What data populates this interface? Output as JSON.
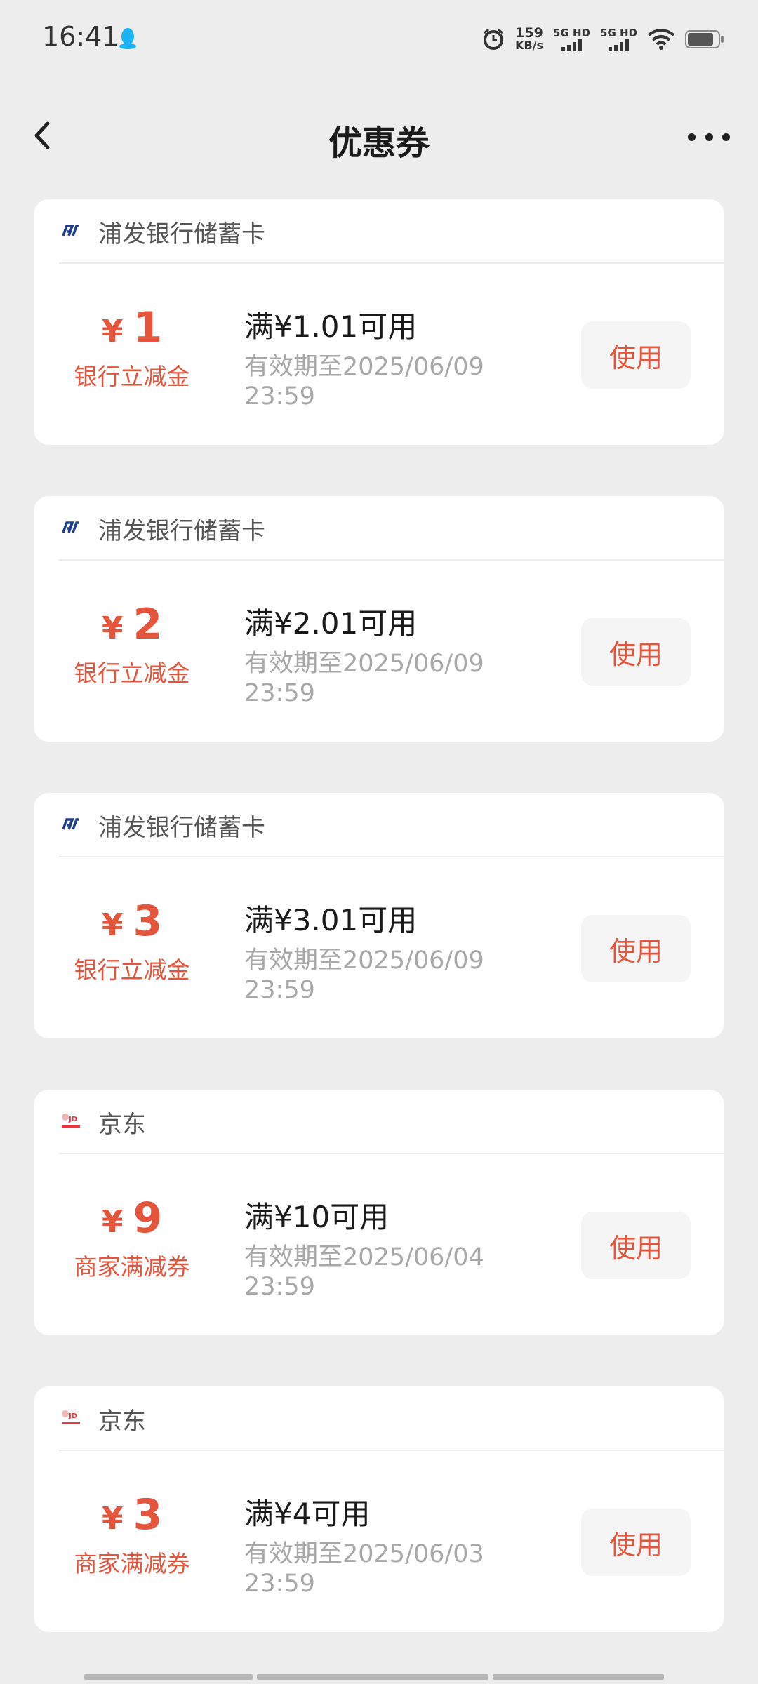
{
  "status": {
    "time": "16:41",
    "speed_value": "159",
    "speed_unit": "KB/s",
    "sim1": "5G HD",
    "sim2": "5G HD"
  },
  "header": {
    "title": "优惠券"
  },
  "coupons": [
    {
      "merchant": "浦发银行储蓄卡",
      "logo_icon": "spdb-logo-icon",
      "currency": "¥",
      "amount": "1",
      "type": "银行立减金",
      "condition": "满¥1.01可用",
      "validity": "有效期至2025/06/09 23:59",
      "button": "使用"
    },
    {
      "merchant": "浦发银行储蓄卡",
      "logo_icon": "spdb-logo-icon",
      "currency": "¥",
      "amount": "2",
      "type": "银行立减金",
      "condition": "满¥2.01可用",
      "validity": "有效期至2025/06/09 23:59",
      "button": "使用"
    },
    {
      "merchant": "浦发银行储蓄卡",
      "logo_icon": "spdb-logo-icon",
      "currency": "¥",
      "amount": "3",
      "type": "银行立减金",
      "condition": "满¥3.01可用",
      "validity": "有效期至2025/06/09 23:59",
      "button": "使用"
    },
    {
      "merchant": "京东",
      "logo_icon": "jd-logo-icon",
      "currency": "¥",
      "amount": "9",
      "type": "商家满减券",
      "condition": "满¥10可用",
      "validity": "有效期至2025/06/04 23:59",
      "button": "使用"
    },
    {
      "merchant": "京东",
      "logo_icon": "jd-logo-icon",
      "currency": "¥",
      "amount": "3",
      "type": "商家满减券",
      "condition": "满¥4可用",
      "validity": "有效期至2025/06/03 23:59",
      "button": "使用"
    }
  ],
  "colors": {
    "accent": "#e5553c",
    "background": "#ededed",
    "card": "#ffffff",
    "muted": "#a8a8a8"
  }
}
